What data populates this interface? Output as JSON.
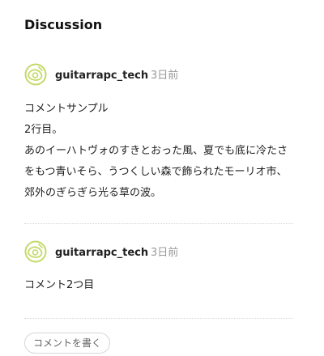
{
  "discussion": {
    "title": "Discussion",
    "comments": [
      {
        "avatar_icon": "guitar-pick-logo-icon",
        "username": "guitarrapc_tech",
        "timestamp": "3日前",
        "body_lines": [
          "コメントサンプル",
          "2行目。",
          "あのイーハトヴォのすきとおった風、夏でも底に冷たさをもつ青いそら、うつくしい森で飾られたモーリオ市、郊外のぎらぎら光る草の波。"
        ]
      },
      {
        "avatar_icon": "guitar-pick-logo-icon",
        "username": "guitarrapc_tech",
        "timestamp": "3日前",
        "body_lines": [
          "コメント2つ目"
        ]
      }
    ],
    "write_button_label": "コメントを書く"
  },
  "colors": {
    "avatar_accent": "#c4d96a",
    "timestamp": "#999999",
    "divider": "#d4d4d4"
  }
}
